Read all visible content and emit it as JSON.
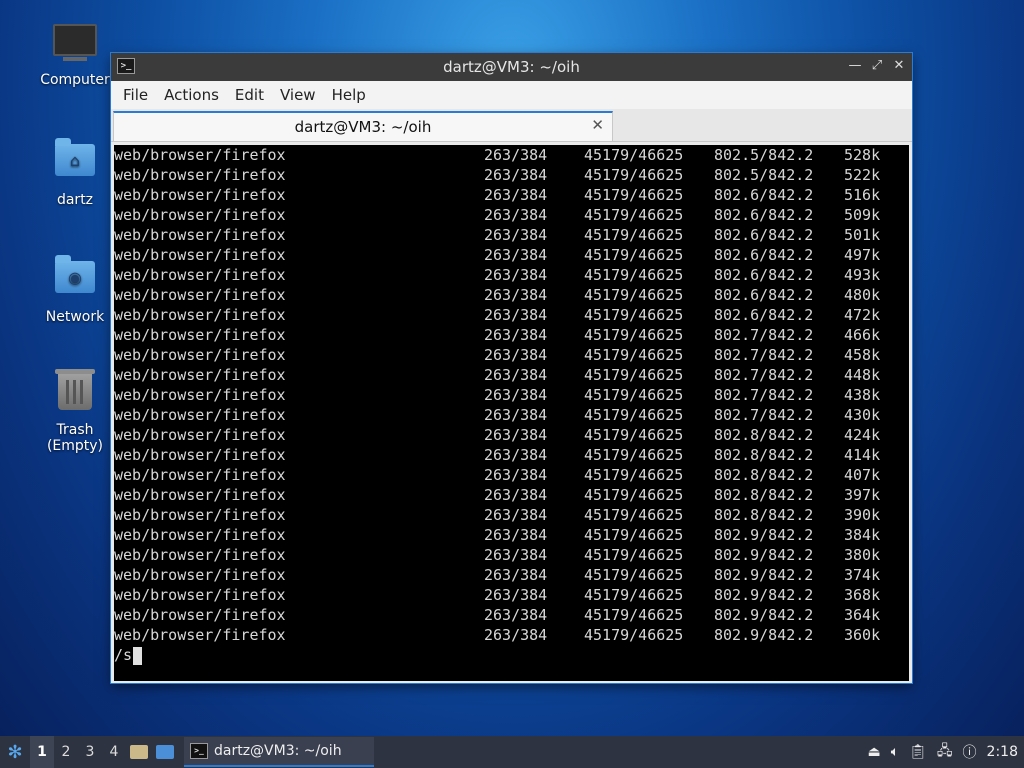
{
  "desktop": {
    "icons": [
      {
        "label": "Computer"
      },
      {
        "label": "dartz"
      },
      {
        "label": "Network"
      },
      {
        "label": "Trash (Empty)"
      }
    ]
  },
  "window": {
    "title": "dartz@VM3: ~/oih",
    "menu": [
      "File",
      "Actions",
      "Edit",
      "View",
      "Help"
    ],
    "tab_label": "dartz@VM3: ~/oih",
    "lines": [
      [
        "web/browser/firefox",
        "263/384",
        "45179/46625",
        "802.5/842.2",
        "528k"
      ],
      [
        "web/browser/firefox",
        "263/384",
        "45179/46625",
        "802.5/842.2",
        "522k"
      ],
      [
        "web/browser/firefox",
        "263/384",
        "45179/46625",
        "802.6/842.2",
        "516k"
      ],
      [
        "web/browser/firefox",
        "263/384",
        "45179/46625",
        "802.6/842.2",
        "509k"
      ],
      [
        "web/browser/firefox",
        "263/384",
        "45179/46625",
        "802.6/842.2",
        "501k"
      ],
      [
        "web/browser/firefox",
        "263/384",
        "45179/46625",
        "802.6/842.2",
        "497k"
      ],
      [
        "web/browser/firefox",
        "263/384",
        "45179/46625",
        "802.6/842.2",
        "493k"
      ],
      [
        "web/browser/firefox",
        "263/384",
        "45179/46625",
        "802.6/842.2",
        "480k"
      ],
      [
        "web/browser/firefox",
        "263/384",
        "45179/46625",
        "802.6/842.2",
        "472k"
      ],
      [
        "web/browser/firefox",
        "263/384",
        "45179/46625",
        "802.7/842.2",
        "466k"
      ],
      [
        "web/browser/firefox",
        "263/384",
        "45179/46625",
        "802.7/842.2",
        "458k"
      ],
      [
        "web/browser/firefox",
        "263/384",
        "45179/46625",
        "802.7/842.2",
        "448k"
      ],
      [
        "web/browser/firefox",
        "263/384",
        "45179/46625",
        "802.7/842.2",
        "438k"
      ],
      [
        "web/browser/firefox",
        "263/384",
        "45179/46625",
        "802.7/842.2",
        "430k"
      ],
      [
        "web/browser/firefox",
        "263/384",
        "45179/46625",
        "802.8/842.2",
        "424k"
      ],
      [
        "web/browser/firefox",
        "263/384",
        "45179/46625",
        "802.8/842.2",
        "414k"
      ],
      [
        "web/browser/firefox",
        "263/384",
        "45179/46625",
        "802.8/842.2",
        "407k"
      ],
      [
        "web/browser/firefox",
        "263/384",
        "45179/46625",
        "802.8/842.2",
        "397k"
      ],
      [
        "web/browser/firefox",
        "263/384",
        "45179/46625",
        "802.8/842.2",
        "390k"
      ],
      [
        "web/browser/firefox",
        "263/384",
        "45179/46625",
        "802.9/842.2",
        "384k"
      ],
      [
        "web/browser/firefox",
        "263/384",
        "45179/46625",
        "802.9/842.2",
        "380k"
      ],
      [
        "web/browser/firefox",
        "263/384",
        "45179/46625",
        "802.9/842.2",
        "374k"
      ],
      [
        "web/browser/firefox",
        "263/384",
        "45179/46625",
        "802.9/842.2",
        "368k"
      ],
      [
        "web/browser/firefox",
        "263/384",
        "45179/46625",
        "802.9/842.2",
        "364k"
      ],
      [
        "web/browser/firefox",
        "263/384",
        "45179/46625",
        "802.9/842.2",
        "360k"
      ]
    ],
    "prompt": "/s"
  },
  "taskbar": {
    "workspaces": [
      "1",
      "2",
      "3",
      "4"
    ],
    "active_workspace": "1",
    "task_label": "dartz@VM3: ~/oih",
    "clock": "2:18"
  }
}
